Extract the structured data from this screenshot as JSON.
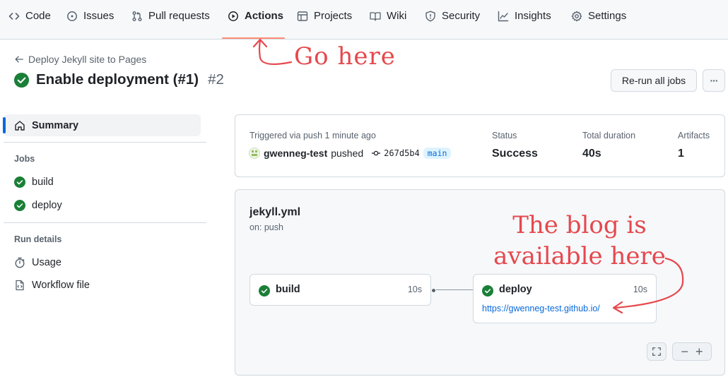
{
  "nav": {
    "items": [
      {
        "label": "Code",
        "icon": "code-icon"
      },
      {
        "label": "Issues",
        "icon": "issue-icon"
      },
      {
        "label": "Pull requests",
        "icon": "pull-request-icon"
      },
      {
        "label": "Actions",
        "icon": "play-icon",
        "active": true
      },
      {
        "label": "Projects",
        "icon": "table-icon"
      },
      {
        "label": "Wiki",
        "icon": "book-icon"
      },
      {
        "label": "Security",
        "icon": "shield-icon"
      },
      {
        "label": "Insights",
        "icon": "graph-icon"
      },
      {
        "label": "Settings",
        "icon": "gear-icon"
      }
    ]
  },
  "header": {
    "breadcrumb": "Deploy Jekyll site to Pages",
    "title": "Enable deployment (#1)",
    "run_number": "#2",
    "rerun_label": "Re-run all jobs",
    "more_label": "···"
  },
  "sidebar": {
    "summary_label": "Summary",
    "jobs_heading": "Jobs",
    "jobs": [
      {
        "label": "build",
        "status": "success"
      },
      {
        "label": "deploy",
        "status": "success"
      }
    ],
    "run_details_heading": "Run details",
    "details": [
      {
        "label": "Usage",
        "icon": "stopwatch-icon"
      },
      {
        "label": "Workflow file",
        "icon": "file-code-icon"
      }
    ]
  },
  "summary": {
    "triggered_label": "Triggered via push 1 minute ago",
    "actor": "gwenneg-test",
    "action": "pushed",
    "commit_sha": "267d5b4",
    "branch": "main",
    "status_label": "Status",
    "status_value": "Success",
    "duration_label": "Total duration",
    "duration_value": "40s",
    "artifacts_label": "Artifacts",
    "artifacts_value": "1"
  },
  "workflow": {
    "name": "jekyll.yml",
    "trigger": "on: push",
    "jobs": [
      {
        "name": "build",
        "duration": "10s"
      },
      {
        "name": "deploy",
        "duration": "10s",
        "url": "https://gwenneg-test.github.io/"
      }
    ],
    "zoom_out_label": "−",
    "zoom_in_label": "+"
  },
  "annotations": {
    "go_here": "Go here",
    "blog_line1": "The blog is",
    "blog_line2": "available here"
  },
  "colors": {
    "success": "#1a7f37",
    "accent": "#0969da",
    "annotation": "#e5484d",
    "active_tab_underline": "#fd8c73"
  }
}
